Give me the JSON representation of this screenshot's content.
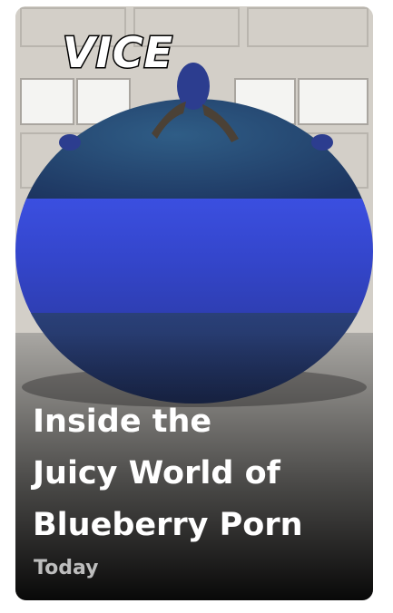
{
  "story": {
    "publisher_logo": "VICE",
    "headline_lines": [
      "Inside the",
      "Juicy World of",
      "Blueberry Porn"
    ],
    "date": "Today"
  },
  "colors": {
    "garage_wall": "#d6d2cb",
    "blueberry_dark": "#253c6e",
    "blueberry_band": "#3447c9",
    "text_primary": "#ffffff",
    "text_secondary": "#bdbdbd"
  }
}
